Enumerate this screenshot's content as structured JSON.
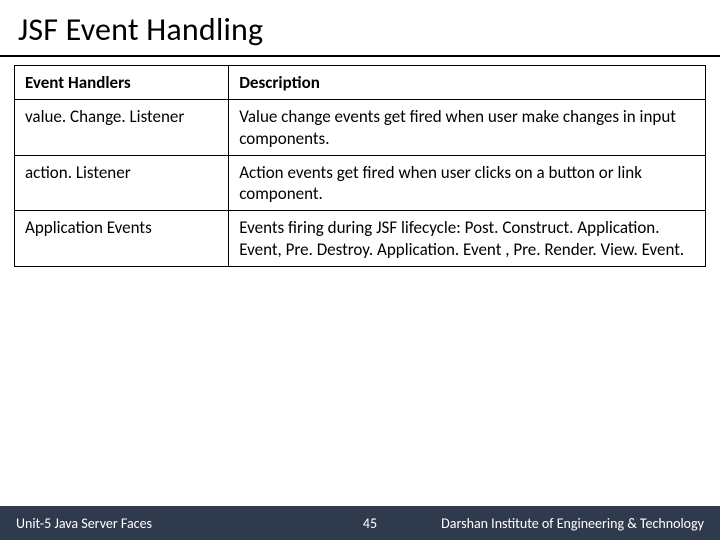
{
  "title": "JSF Event Handling",
  "table": {
    "headers": {
      "col1": "Event Handlers",
      "col2": "Description"
    },
    "rows": [
      {
        "name": "value. Change. Listener",
        "desc": "Value change events get fired when user make changes in input components."
      },
      {
        "name": "action. Listener",
        "desc": "Action events get fired when user clicks on a button or link component."
      },
      {
        "name": "Application Events",
        "desc": "Events firing during JSF lifecycle: Post. Construct. Application. Event, Pre. Destroy. Application. Event , Pre. Render. View. Event."
      }
    ]
  },
  "footer": {
    "unit": "Unit-5 Java Server Faces",
    "page": "45",
    "institute": "Darshan Institute of Engineering & Technology"
  }
}
